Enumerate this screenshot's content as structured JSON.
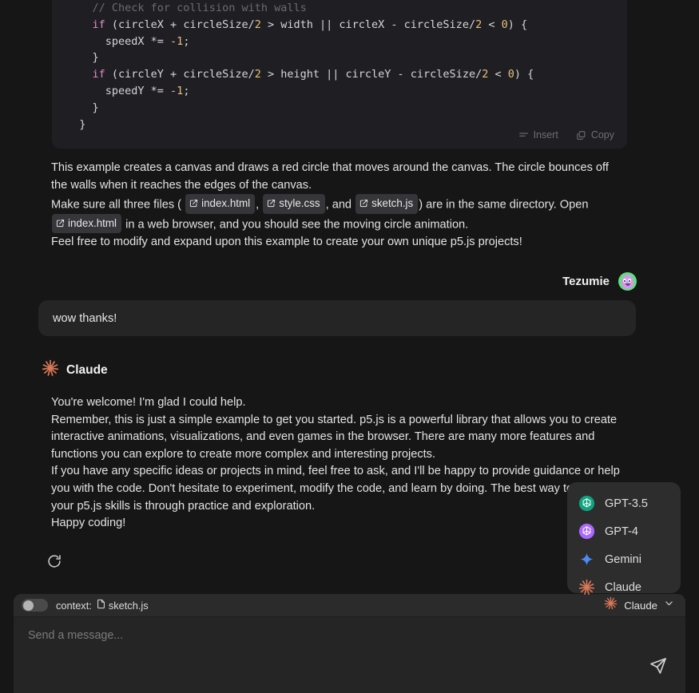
{
  "code_block": {
    "lines": [
      {
        "segs": [
          {
            "t": "    // Check for collision with walls",
            "c": "com"
          }
        ]
      },
      {
        "segs": [
          {
            "t": "    ",
            "c": "pl"
          },
          {
            "t": "if",
            "c": "kw"
          },
          {
            "t": " (circleX + circleSize/",
            "c": "pl"
          },
          {
            "t": "2",
            "c": "num"
          },
          {
            "t": " > width || circleX - circleSize/",
            "c": "pl"
          },
          {
            "t": "2",
            "c": "num"
          },
          {
            "t": " < ",
            "c": "pl"
          },
          {
            "t": "0",
            "c": "num"
          },
          {
            "t": ") {",
            "c": "pl"
          }
        ]
      },
      {
        "segs": [
          {
            "t": "      speedX *= ",
            "c": "pl"
          },
          {
            "t": "-1",
            "c": "num"
          },
          {
            "t": ";",
            "c": "pl"
          }
        ]
      },
      {
        "segs": [
          {
            "t": "    }",
            "c": "pl"
          }
        ]
      },
      {
        "segs": [
          {
            "t": "    ",
            "c": "pl"
          },
          {
            "t": "if",
            "c": "kw"
          },
          {
            "t": " (circleY + circleSize/",
            "c": "pl"
          },
          {
            "t": "2",
            "c": "num"
          },
          {
            "t": " > height || circleY - circleSize/",
            "c": "pl"
          },
          {
            "t": "2",
            "c": "num"
          },
          {
            "t": " < ",
            "c": "pl"
          },
          {
            "t": "0",
            "c": "num"
          },
          {
            "t": ") {",
            "c": "pl"
          }
        ]
      },
      {
        "segs": [
          {
            "t": "      speedY *= ",
            "c": "pl"
          },
          {
            "t": "-1",
            "c": "num"
          },
          {
            "t": ";",
            "c": "pl"
          }
        ]
      },
      {
        "segs": [
          {
            "t": "    }",
            "c": "pl"
          }
        ]
      },
      {
        "segs": [
          {
            "t": "  }",
            "c": "pl"
          }
        ]
      }
    ],
    "insert_label": "Insert",
    "copy_label": "Copy"
  },
  "prose": {
    "para1": "This example creates a canvas and draws a red circle that moves around the canvas. The circle bounces off the walls when it reaches the edges of the canvas.",
    "para2_a": "Make sure all three files (",
    "chip1": "index.html",
    "sep1": ",",
    "chip2": "style.css",
    "sep2": ", and",
    "chip3": "sketch.js",
    "para2_b": ") are in the same directory. Open",
    "chip4": "index.html",
    "para2_c": "in a web browser, and you should see the moving circle animation.",
    "para3": "Feel free to modify and expand upon this example to create your own unique p5.js projects!"
  },
  "user_turn": {
    "name": "Tezumie",
    "message": "wow thanks!"
  },
  "assistant_turn": {
    "name": "Claude",
    "para1": "You're welcome! I'm glad I could help.",
    "para2": "Remember, this is just a simple example to get you started. p5.js is a powerful library that allows you to create interactive animations, visualizations, and even games in the browser. There are many more features and functions you can explore to create more complex and interesting projects.",
    "para3": "If you have any specific ideas or projects in mind, feel free to ask, and I'll be happy to provide guidance or help you with the code. Don't hesitate to experiment, modify the code, and learn by doing. The best way to improve your p5.js skills is through practice and exploration.",
    "para4": "Happy coding!"
  },
  "model_menu": {
    "items": [
      {
        "label": "GPT-3.5",
        "icon": "openai-green-icon"
      },
      {
        "label": "GPT-4",
        "icon": "openai-purple-icon"
      },
      {
        "label": "Gemini",
        "icon": "gemini-star-icon"
      },
      {
        "label": "Claude",
        "icon": "claude-starburst-icon"
      }
    ]
  },
  "composer": {
    "context_label": "context:",
    "context_file": "sketch.js",
    "selected_model": "Claude",
    "placeholder": "Send a message..."
  },
  "colors": {
    "page_bg": "#161616",
    "code_bg": "#1f1f23",
    "bubble_bg": "#252525",
    "menu_bg": "#2d2d2d",
    "claude_accent": "#d97757",
    "gpt35_accent": "#10a37f",
    "gpt4_accent": "#ab68ff",
    "gemini_accent": "#4c8bf5"
  }
}
